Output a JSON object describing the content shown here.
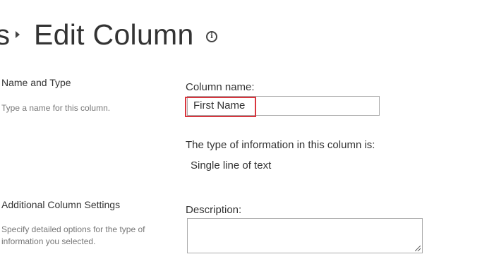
{
  "header": {
    "breadcrumb_fragment": "s",
    "title": "Edit Column",
    "info_icon": "info-icon"
  },
  "sections": {
    "name_and_type": {
      "title": "Name and Type",
      "description": "Type a name for this column."
    },
    "additional_settings": {
      "title": "Additional Column Settings",
      "description": "Specify detailed options for the type of information you selected."
    }
  },
  "form": {
    "column_name_label": "Column name:",
    "column_name_value": "First Name",
    "type_label": "The type of information in this column is:",
    "type_value": "Single line of text",
    "description_label": "Description:",
    "description_value": ""
  },
  "colors": {
    "highlight": "#d9363e"
  }
}
